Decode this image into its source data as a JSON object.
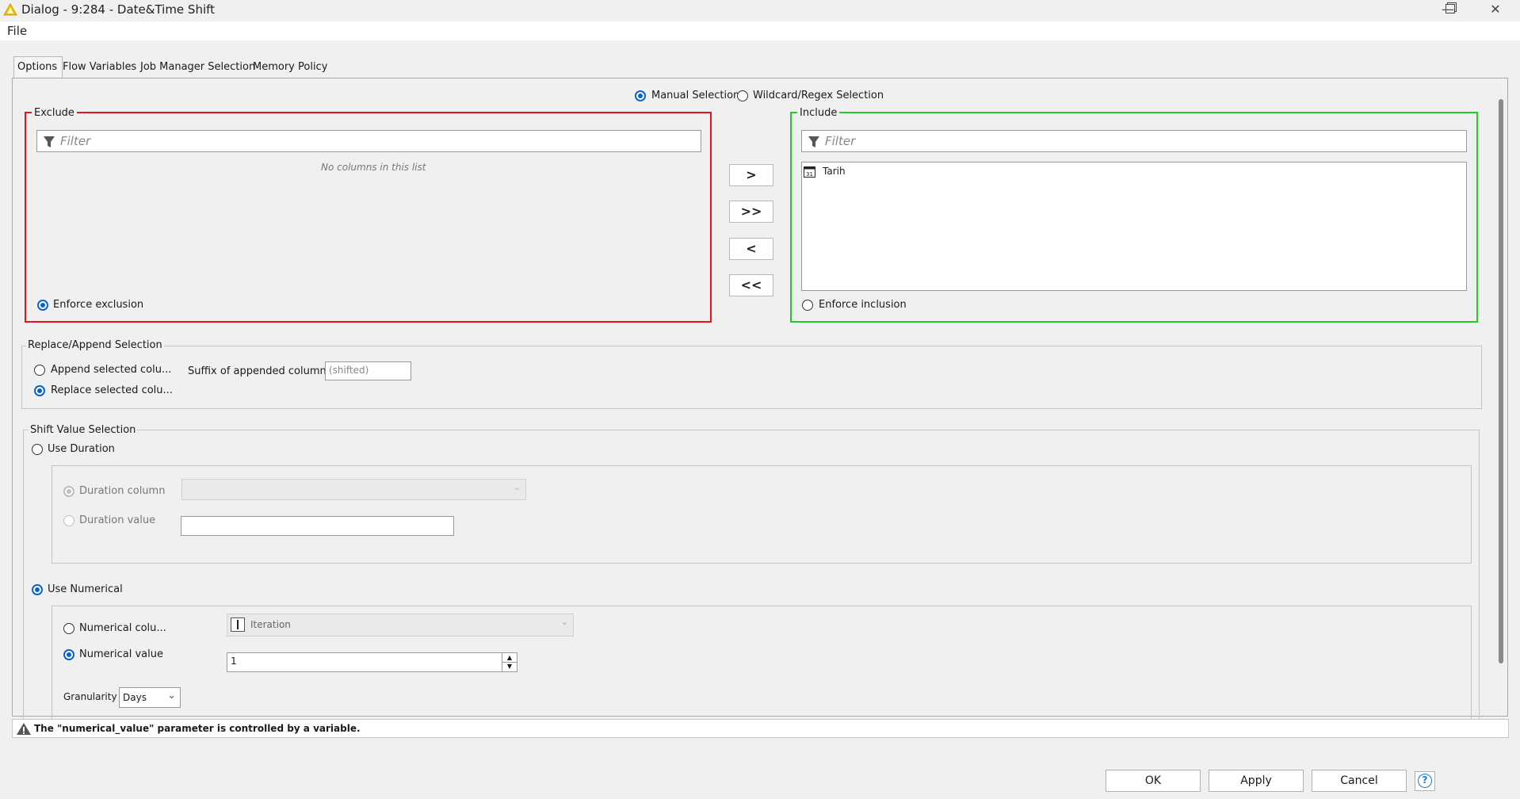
{
  "window": {
    "title": "Dialog - 9:284 - Date&Time Shift",
    "minimize_icon": "minimize-icon",
    "restore_icon": "restore-icon",
    "close_icon": "close-icon"
  },
  "menu": {
    "file": "File"
  },
  "tabs": [
    {
      "label": "Options",
      "active": true
    },
    {
      "label": "Flow Variables"
    },
    {
      "label": "Job Manager Selection"
    },
    {
      "label": "Memory Policy"
    }
  ],
  "selection_mode": {
    "manual": "Manual Selection",
    "wildcard": "Wildcard/Regex Selection",
    "selected": "manual"
  },
  "exclude": {
    "title": "Exclude",
    "filter_placeholder": "Filter",
    "empty_text": "No columns in this list",
    "enforce_label": "Enforce exclusion",
    "enforce_selected": true,
    "accent_color": "#e8121d"
  },
  "include": {
    "title": "Include",
    "filter_placeholder": "Filter",
    "items": [
      {
        "label": "Tarih",
        "icon": "calendar-icon"
      }
    ],
    "enforce_label": "Enforce inclusion",
    "enforce_selected": false,
    "accent_color": "#22cc22"
  },
  "move_buttons": {
    "add": ">",
    "add_all": ">>",
    "remove": "<",
    "remove_all": "<<"
  },
  "replace_append": {
    "title": "Replace/Append Selection",
    "append_label": "Append selected colu...",
    "replace_label": "Replace selected colu...",
    "selected": "replace",
    "suffix_label": "Suffix of appended columns:",
    "suffix_value": "(shifted)"
  },
  "shift_value": {
    "title": "Shift Value Selection",
    "use_duration_label": "Use Duration",
    "duration_column_label": "Duration column",
    "duration_value_label": "Duration value",
    "duration_value": "",
    "use_numerical_label": "Use Numerical",
    "numerical_column_label": "Numerical colu...",
    "numerical_column_value": "Iteration",
    "numerical_value_label": "Numerical value",
    "numerical_value": "1",
    "granularity_label": "Granularity",
    "granularity_value": "Days",
    "selected": "numerical"
  },
  "status": {
    "message": "The \"numerical_value\" parameter is controlled by a variable.",
    "icon": "warning-icon"
  },
  "buttons": {
    "ok": "OK",
    "apply": "Apply",
    "cancel": "Cancel",
    "help_icon": "help-icon"
  }
}
